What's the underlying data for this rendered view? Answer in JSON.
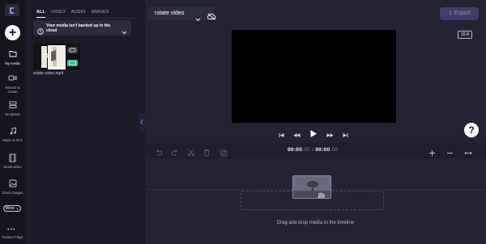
{
  "rail": {
    "items": [
      {
        "label": "My media",
        "icon": "folder-icon"
      },
      {
        "label": "Record & create",
        "icon": "video-camera-icon"
      },
      {
        "label": "Templates",
        "icon": "templates-icon"
      },
      {
        "label": "Music & SFX",
        "icon": "music-note-icon"
      },
      {
        "label": "Stock video",
        "icon": "film-icon"
      },
      {
        "label": "Stock images",
        "icon": "image-icon"
      }
    ],
    "more_label": "More",
    "feature_label": "Feature Flags"
  },
  "media": {
    "tabs": [
      "ALL",
      "VIDEO",
      "AUDIO",
      "IMAGES"
    ],
    "notice": "Your media isn't backed up in the cloud",
    "file_name": "rotate video.mp4"
  },
  "header": {
    "project_title": "rotate video",
    "export_label": "Export",
    "aspect_ratio": "16:9"
  },
  "timeline": {
    "current_time_main": "00:00",
    "current_time_frac": ".00",
    "separator": "/",
    "total_time_main": "00:00",
    "total_time_frac": ".00",
    "drop_text": "Drag and drop media to the timeline"
  },
  "help_label": "?",
  "colors": {
    "background": "#232334",
    "panel": "#1a1a29",
    "export_button": "#3e3e6a"
  }
}
